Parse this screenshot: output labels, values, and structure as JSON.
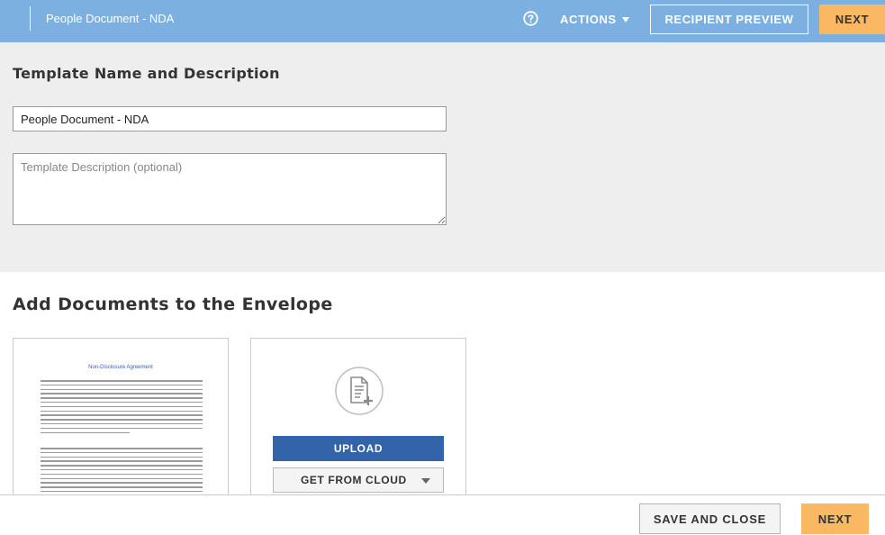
{
  "header": {
    "document_title": "People Document - NDA",
    "help_icon": "question-circle-icon",
    "actions_label": "ACTIONS",
    "recipient_preview_label": "RECIPIENT PREVIEW",
    "next_label": "NEXT"
  },
  "template_section": {
    "heading": "Template Name and Description",
    "name_value": "People Document - NDA",
    "description_placeholder": "Template Description (optional)",
    "description_value": ""
  },
  "documents_section": {
    "heading": "Add Documents to the Envelope",
    "document_preview": {
      "page_title": "Non-Disclosure Agreement"
    },
    "upload_icon": "add-document-icon",
    "upload_label": "UPLOAD",
    "get_from_cloud_label": "GET FROM CLOUD"
  },
  "footer": {
    "save_and_close_label": "SAVE AND CLOSE",
    "next_label": "NEXT"
  },
  "colors": {
    "header_bg": "#7bb0e0",
    "next_button": "#fbb863",
    "upload_button": "#3363a8",
    "section_bg": "#eeeeee"
  }
}
